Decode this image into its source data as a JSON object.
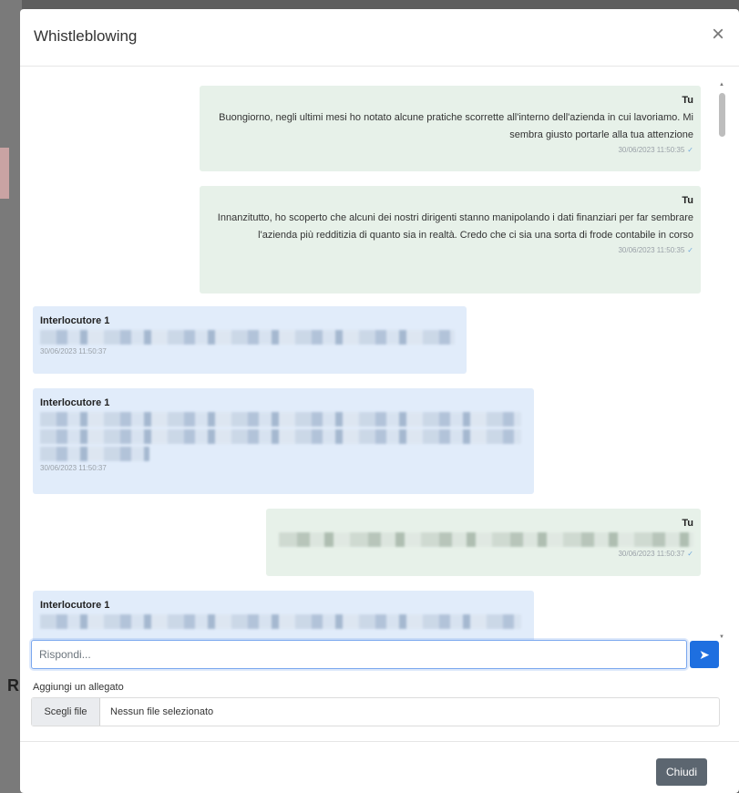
{
  "modal": {
    "title": "Whistleblowing",
    "close_symbol": "×"
  },
  "messages": [
    {
      "sender": "Tu",
      "text": "Buongiorno, negli ultimi mesi ho notato alcune pratiche scorrette all'interno dell'azienda in cui lavoriamo. Mi sembra giusto portarle alla tua attenzione",
      "timestamp": "30/06/2023 11:50:35",
      "blurred": false
    },
    {
      "sender": "Tu",
      "text": "Innanzitutto, ho scoperto che alcuni dei nostri dirigenti stanno manipolando i dati finanziari per far sembrare l'azienda più redditizia di quanto sia in realtà. Credo che ci sia una sorta di frode contabile in corso",
      "timestamp": "30/06/2023 11:50:35",
      "blurred": false
    },
    {
      "sender": "Interlocutore 1",
      "timestamp": "30/06/2023 11:50:37",
      "blurred": true
    },
    {
      "sender": "Interlocutore 1",
      "timestamp": "30/06/2023 11:50:37",
      "blurred": true
    },
    {
      "sender": "Tu",
      "timestamp": "30/06/2023 11:50:37",
      "blurred": true
    },
    {
      "sender": "Interlocutore 1",
      "blurred": true
    }
  ],
  "reply": {
    "placeholder": "Rispondi..."
  },
  "attachment": {
    "label": "Aggiungi un allegato",
    "choose_label": "Scegli file",
    "no_file_label": "Nessun file selezionato"
  },
  "footer": {
    "close_label": "Chiudi"
  },
  "colors": {
    "accent": "#1e6fe0",
    "own_bubble": "#e7f1e9",
    "other_bubble": "#e1ecfa",
    "secondary_button": "#5c6670"
  }
}
